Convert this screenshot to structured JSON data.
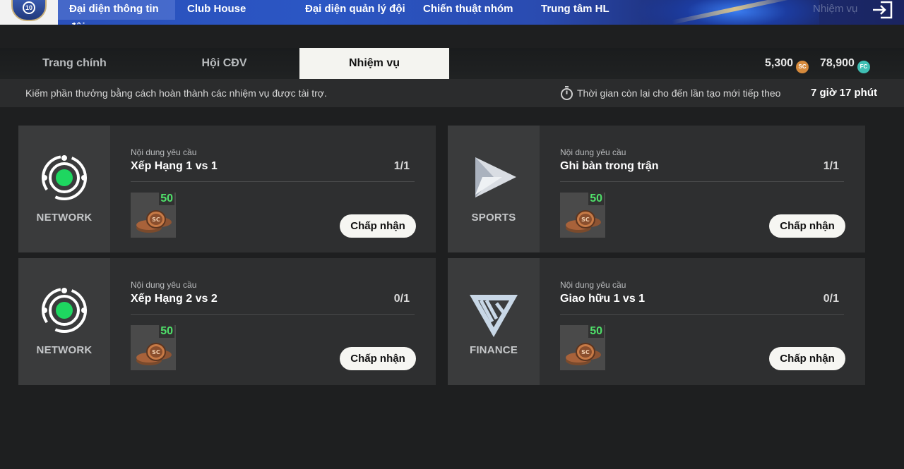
{
  "topnav": {
    "logo_number": "10",
    "items": [
      {
        "label": "Đại diện thông tin đội"
      },
      {
        "label": "Club House"
      },
      {
        "label": "Đại diện quản lý đội"
      },
      {
        "label": "Chiến thuật nhóm"
      },
      {
        "label": "Trung tâm HL"
      },
      {
        "label": "Nhiệm vụ"
      }
    ]
  },
  "tabs": [
    {
      "label": "Trang chính",
      "active": false
    },
    {
      "label": "Hội CĐV",
      "active": false
    },
    {
      "label": "Nhiệm vụ",
      "active": true
    }
  ],
  "currency": {
    "sc_amount": "5,300",
    "sc_icon": "SC",
    "fc_amount": "78,900",
    "fc_icon": "FC"
  },
  "info": {
    "description": "Kiếm phần thưởng bằng cách hoàn thành các nhiệm vụ được tài trợ.",
    "timer_label": "Thời gian còn lại cho đến lần tạo mới tiếp theo",
    "timer_value": "7 giờ 17 phút"
  },
  "missions": [
    {
      "sponsor": "NETWORK",
      "sponsor_icon": "network-icon",
      "req_label": "Nội dung yêu cầu",
      "title": "Xếp Hạng 1 vs 1",
      "progress": "1/1",
      "reward_amount": "50",
      "reward_coin": "SC",
      "button": "Chấp nhận"
    },
    {
      "sponsor": "SPORTS",
      "sponsor_icon": "sports-icon",
      "req_label": "Nội dung yêu cầu",
      "title": "Ghi bàn trong trận",
      "progress": "1/1",
      "reward_amount": "50",
      "reward_coin": "SC",
      "button": "Chấp nhận"
    },
    {
      "sponsor": "NETWORK",
      "sponsor_icon": "network-icon",
      "req_label": "Nội dung yêu cầu",
      "title": "Xếp Hạng 2 vs 2",
      "progress": "0/1",
      "reward_amount": "50",
      "reward_coin": "SC",
      "button": "Chấp nhận"
    },
    {
      "sponsor": "FINANCE",
      "sponsor_icon": "finance-icon",
      "req_label": "Nội dung yêu cầu",
      "title": "Giao hữu 1 vs 1",
      "progress": "0/1",
      "reward_amount": "50",
      "reward_coin": "SC",
      "button": "Chấp nhận"
    }
  ]
}
